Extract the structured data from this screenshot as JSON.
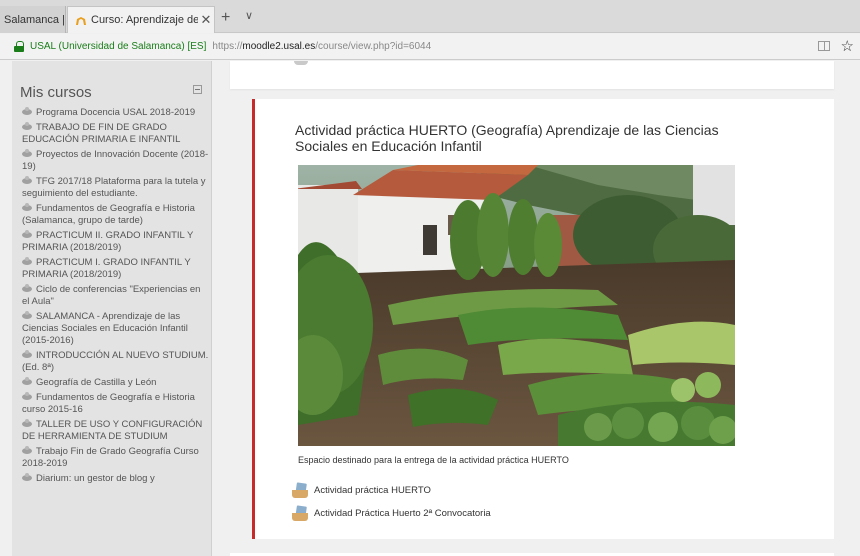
{
  "browser": {
    "tab_prev": "Salamanca |",
    "tab_active": "Curso: Aprendizaje de la",
    "tab_new_symbol": "+",
    "tab_menu_symbol": "∨",
    "tab_close_symbol": "✕",
    "address_org": "USAL (Universidad de Salamanca) [ES]",
    "url_prefix": "https://",
    "url_host": "moodle2.usal.es",
    "url_path": "/course/view.php?id=6044",
    "star_symbol": "☆"
  },
  "sidebar": {
    "title": "Mis cursos",
    "courses": [
      "Programa Docencia USAL 2018-2019",
      "TRABAJO DE FIN DE GRADO EDUCACIÓN PRIMARIA E INFANTIL",
      "Proyectos de Innovación Docente (2018-19)",
      "TFG 2017/18 Plataforma para la tutela y seguimiento del estudiante.",
      "Fundamentos de Geografía e Historia (Salamanca, grupo de tarde)",
      "PRACTICUM II. GRADO INFANTIL Y PRIMARIA (2018/2019)",
      "PRACTICUM I. GRADO INFANTIL Y PRIMARIA (2018/2019)",
      "Ciclo de conferencias \"Experiencias en el Aula\"",
      "SALAMANCA - Aprendizaje de las Ciencias Sociales en Educación Infantil (2015-2016)",
      "INTRODUCCIÓN AL NUEVO STUDIUM. (Ed. 8ª)",
      "Geografía de Castilla y León",
      "Fundamentos de Geografía e Historia curso 2015-16",
      "TALLER DE USO Y CONFIGURACIÓN DE HERRAMIENTA DE STUDIUM",
      "Trabajo Fin de Grado Geografía Curso 2018-2019",
      "Diarium: un gestor de blog y"
    ]
  },
  "section": {
    "title": "Actividad práctica HUERTO (Geografía) Aprendizaje de las Ciencias Sociales en Educación Infantil",
    "caption": "Espacio destinado para la entrega de la actividad práctica HUERTO",
    "activities": [
      "Actividad práctica HUERTO",
      "Actividad Práctica Huerto 2ª Convocatoria"
    ]
  },
  "colors": {
    "accent_border": "#c52b2b",
    "secure_green": "#1a7d1a",
    "tab_favicon": "#e9a020"
  }
}
